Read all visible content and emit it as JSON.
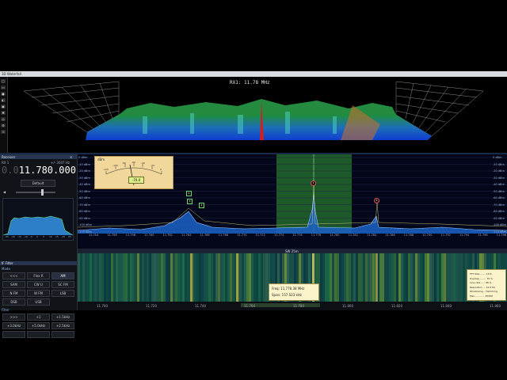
{
  "window": {
    "title": "3D Waterfall"
  },
  "rx_title": "RX1: 11.78 MHz",
  "left_toolbar": {
    "buttons": [
      "▢",
      "▭",
      "●",
      "◐",
      "▣",
      "✱",
      "◎",
      "⚙",
      "⊙"
    ]
  },
  "left_panel": {
    "header": "Receiver",
    "rx_label": "RX 1",
    "span_label": "+/- 3047 Hz",
    "frequency_dim": "0.0",
    "frequency": "11.780.000",
    "preset": "Default",
    "mode_section": "IF Filter",
    "mode_sub": "Mode",
    "mode_buttons": [
      [
        "<<<",
        "Flex R",
        "AM"
      ],
      [
        "SAM",
        "CW U",
        "SC FM"
      ],
      [
        "N FM",
        "W FM",
        "LSB"
      ],
      [
        "DSB",
        "USB",
        ""
      ]
    ],
    "filter_section": "Filter",
    "filter_buttons": [
      [
        ">>>",
        "+1",
        "+1.5kHz"
      ],
      [
        "+3.0kHz",
        "+5.0kHz",
        "+2.5kHz"
      ],
      [
        "",
        "",
        ""
      ]
    ],
    "mini_axis": [
      "-25",
      "-20",
      "-15",
      "-10",
      "-5",
      "0",
      "5",
      "10",
      "15",
      "20",
      "25"
    ]
  },
  "meter": {
    "unit": "dBm",
    "scale": [
      "-120",
      "-100",
      "-80",
      "-60",
      "-40",
      "-20",
      "0"
    ],
    "value": "-70.0"
  },
  "panadapter": {
    "db_left": [
      "0 dBm",
      "-10 dBm",
      "-20 dBm",
      "-30 dBm",
      "-40 dBm",
      "-50 dBm",
      "-60 dBm",
      "-70 dBm",
      "-80 dBm",
      "-90 dBm",
      "-100 dBm",
      "-110 dBm"
    ],
    "db_right": [
      "0 dBm",
      "-10 dBm",
      "-20 dBm",
      "-30 dBm",
      "-40 dBm",
      "-50 dBm",
      "-60 dBm",
      "-70 dBm",
      "-80 dBm",
      "-90 dBm",
      "-100 dBm",
      "-110 dBm"
    ],
    "freq_axis": [
      "11.754",
      "11.756",
      "11.758",
      "11.760",
      "11.762",
      "11.764",
      "11.766",
      "11.768",
      "11.770",
      "11.772",
      "11.774",
      "11.776",
      "11.778",
      "11.780",
      "11.782",
      "11.784",
      "11.786",
      "11.788",
      "11.790",
      "11.792",
      "11.794",
      "11.796",
      "11.798"
    ],
    "band_label": "SW 25m",
    "markers": [
      "1",
      "2",
      "3",
      "4",
      "5"
    ]
  },
  "waterfall": {
    "bottom_axis": [
      "11.700",
      "11.720",
      "11.740",
      "11.760",
      "11.780",
      "11.800",
      "11.820",
      "11.840",
      "11.860"
    ],
    "tooltip": {
      "freq": "Freq: 11,778.38 MHz",
      "span": "Span: 157.523 kHz"
    },
    "info": [
      "FFT Size ....... 16 K",
      "Overlap ........ 75 %",
      "Line rate ..... 98 /s",
      "Resolution ... 12.6 Hz",
      "Windowing .. Hamming",
      "Plan ............ ESTIM"
    ]
  },
  "colors": {
    "accent": "#3fbf3f",
    "background": "#000000",
    "peak": "#d02020"
  }
}
